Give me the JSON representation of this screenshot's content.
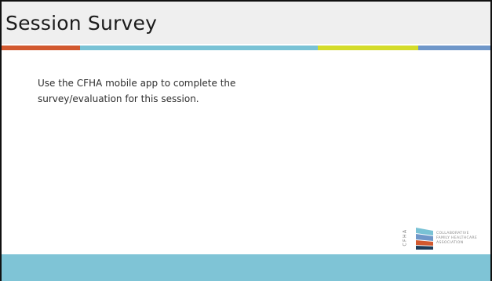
{
  "slide": {
    "title": "Session Survey",
    "body_line_1": "Use the CFHA mobile app to complete the",
    "body_line_2": "survey/evaluation for this session."
  },
  "logo": {
    "vertical_text": "CFHA",
    "line_1": "COLLABORATIVE",
    "line_2": "FAMILY HEALTHCARE",
    "line_3": "ASSOCIATION"
  },
  "colors": {
    "stripe_orange": "#d2592f",
    "stripe_light_blue": "#79c2d5",
    "stripe_yellow_green": "#d4dc2a",
    "stripe_steel_blue": "#6f97c9",
    "footer_band": "#7fc4d6",
    "title_bar": "#efefef"
  }
}
